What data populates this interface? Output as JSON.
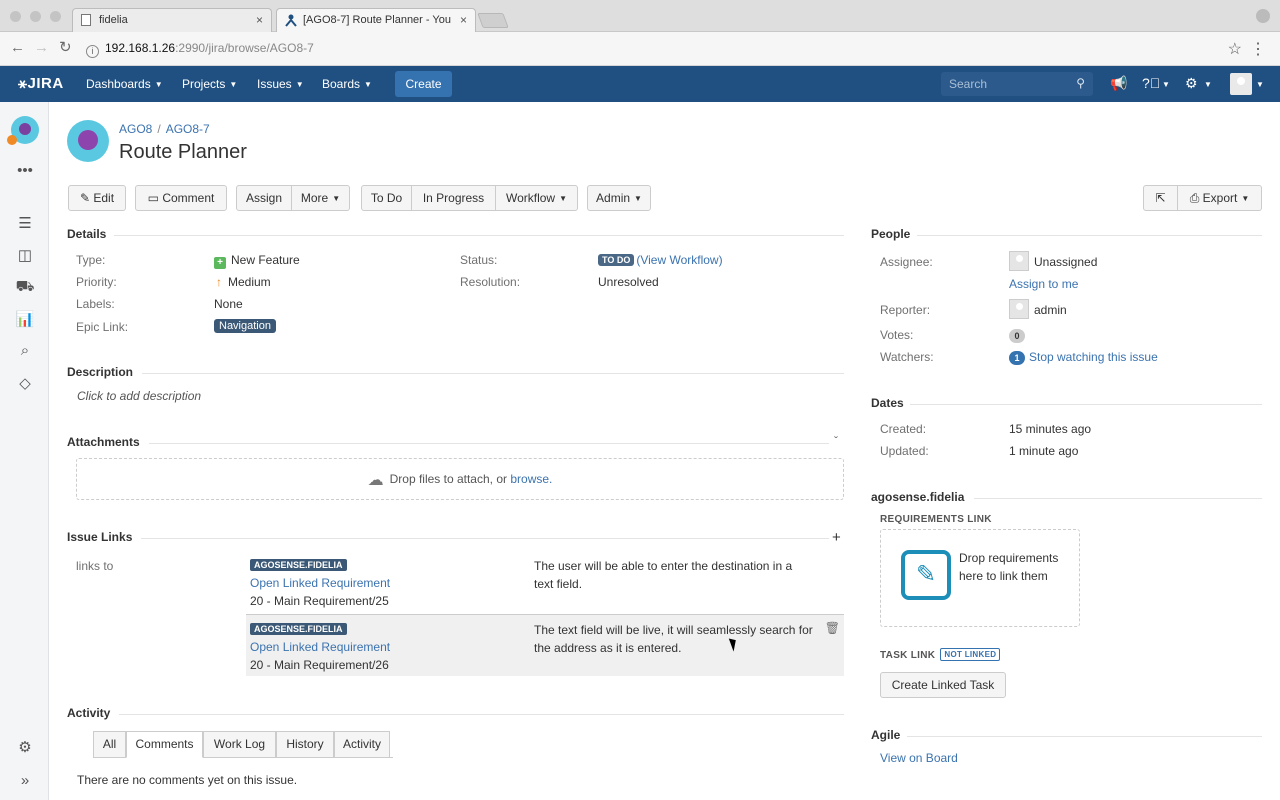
{
  "browser": {
    "tabs": [
      {
        "title": "fidelia"
      },
      {
        "title": "[AGO8-7] Route Planner - You"
      }
    ],
    "url_host": "192.168.1.26",
    "url_rest": ":2990/jira/browse/AGO8-7"
  },
  "header": {
    "logo": "JIRA",
    "nav": [
      "Dashboards",
      "Projects",
      "Issues",
      "Boards"
    ],
    "create_label": "Create",
    "search_placeholder": "Search"
  },
  "issue": {
    "project": "AGO8",
    "key": "AGO8-7",
    "title": "Route Planner"
  },
  "toolbar": {
    "edit": "Edit",
    "comment": "Comment",
    "assign": "Assign",
    "more": "More",
    "todo": "To Do",
    "in_progress": "In Progress",
    "workflow": "Workflow",
    "admin": "Admin",
    "export": "Export"
  },
  "details": {
    "title": "Details",
    "type_label": "Type:",
    "type_value": "New Feature",
    "priority_label": "Priority:",
    "priority_value": "Medium",
    "labels_label": "Labels:",
    "labels_value": "None",
    "epic_label": "Epic Link:",
    "epic_value": "Navigation",
    "status_label": "Status:",
    "status_value": "TO DO",
    "status_link": "(View Workflow)",
    "resolution_label": "Resolution:",
    "resolution_value": "Unresolved"
  },
  "description": {
    "title": "Description",
    "placeholder": "Click to add description"
  },
  "attachments": {
    "title": "Attachments",
    "drop_text": "Drop files to attach, or",
    "browse": "browse."
  },
  "issue_links": {
    "title": "Issue Links",
    "relation": "links to",
    "items": [
      {
        "tag": "AGOSENSE.FIDELIA",
        "link": "Open Linked Requirement",
        "sub": "20 - Main Requirement/25",
        "desc": "The user will be able to enter the destination in a text field."
      },
      {
        "tag": "AGOSENSE.FIDELIA",
        "link": "Open Linked Requirement",
        "sub": "20 - Main Requirement/26",
        "desc": "The text field will be live, it will seamlessly search for the address as it is entered."
      }
    ]
  },
  "activity": {
    "title": "Activity",
    "tabs": [
      "All",
      "Comments",
      "Work Log",
      "History",
      "Activity"
    ],
    "active_tab": "Comments",
    "empty": "There are no comments yet on this issue."
  },
  "people": {
    "title": "People",
    "assignee_label": "Assignee:",
    "assignee_value": "Unassigned",
    "assign_to_me": "Assign to me",
    "reporter_label": "Reporter:",
    "reporter_value": "admin",
    "votes_label": "Votes:",
    "votes_value": "0",
    "watchers_label": "Watchers:",
    "watchers_count": "1",
    "watchers_link": "Stop watching this issue"
  },
  "dates": {
    "title": "Dates",
    "created_label": "Created:",
    "created_value": "15 minutes ago",
    "updated_label": "Updated:",
    "updated_value": "1 minute ago"
  },
  "fidelia": {
    "title": "agosense.fidelia",
    "req_link_title": "REQUIREMENTS LINK",
    "drop_req": "Drop requirements here to link them",
    "task_link_title": "TASK LINK",
    "not_linked": "NOT LINKED",
    "create_task": "Create Linked Task"
  },
  "agile": {
    "title": "Agile",
    "view_board": "View on Board"
  },
  "colors": {
    "header_bg": "#205081",
    "link": "#3b73af",
    "lozenge": "#3b5976"
  }
}
